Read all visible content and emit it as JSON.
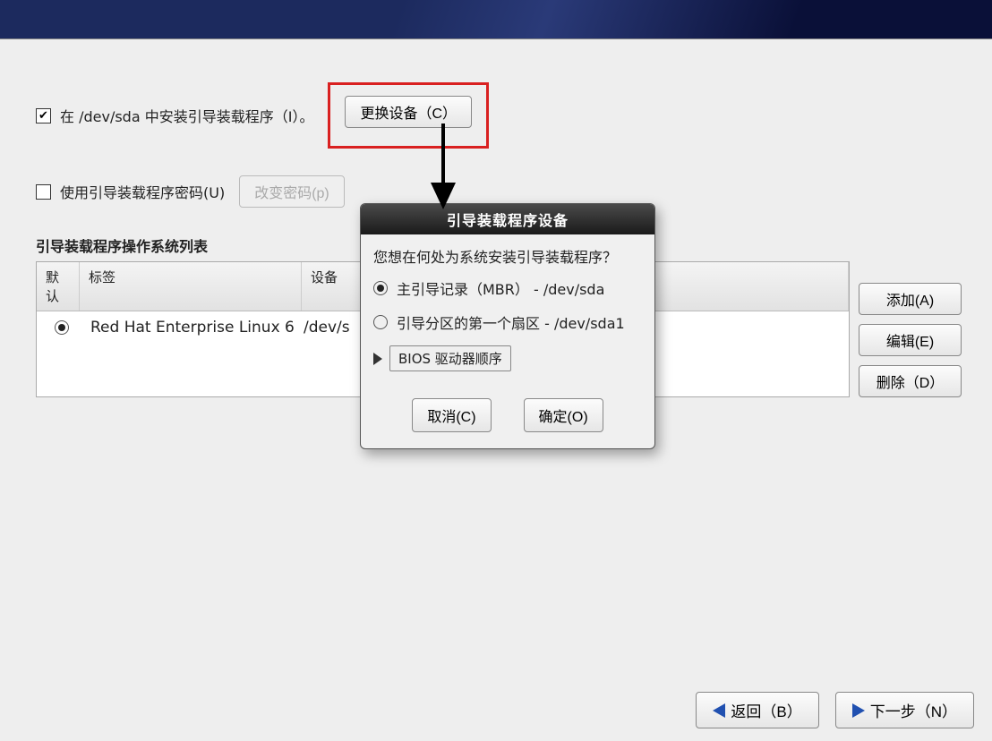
{
  "checkbox_install": {
    "checked": true,
    "label": "在 /dev/sda 中安装引导装载程序（I）。"
  },
  "change_device_btn": "更换设备（C）",
  "checkbox_password": {
    "checked": false,
    "label": "使用引导装载程序密码(U)"
  },
  "change_password_btn": "改变密码(p)",
  "os_list_title": "引导装载程序操作系统列表",
  "table": {
    "headers": {
      "default": "默认",
      "label": "标签",
      "device": "设备"
    },
    "rows": [
      {
        "selected": true,
        "label": "Red Hat Enterprise Linux 6",
        "device": "/dev/s"
      }
    ]
  },
  "side_buttons": {
    "add": "添加(A)",
    "edit": "编辑(E)",
    "delete": "删除（D）"
  },
  "footer": {
    "back": "返回（B）",
    "next": "下一步（N）"
  },
  "dialog": {
    "title": "引导装载程序设备",
    "question": "您想在何处为系统安装引导装载程序？",
    "options": [
      {
        "selected": true,
        "text": "主引导记录（MBR） - /dev/sda"
      },
      {
        "selected": false,
        "text": "引导分区的第一个扇区 - /dev/sda1"
      }
    ],
    "bios": "BIOS 驱动器顺序",
    "cancel": "取消(C)",
    "ok": "确定(O)"
  }
}
